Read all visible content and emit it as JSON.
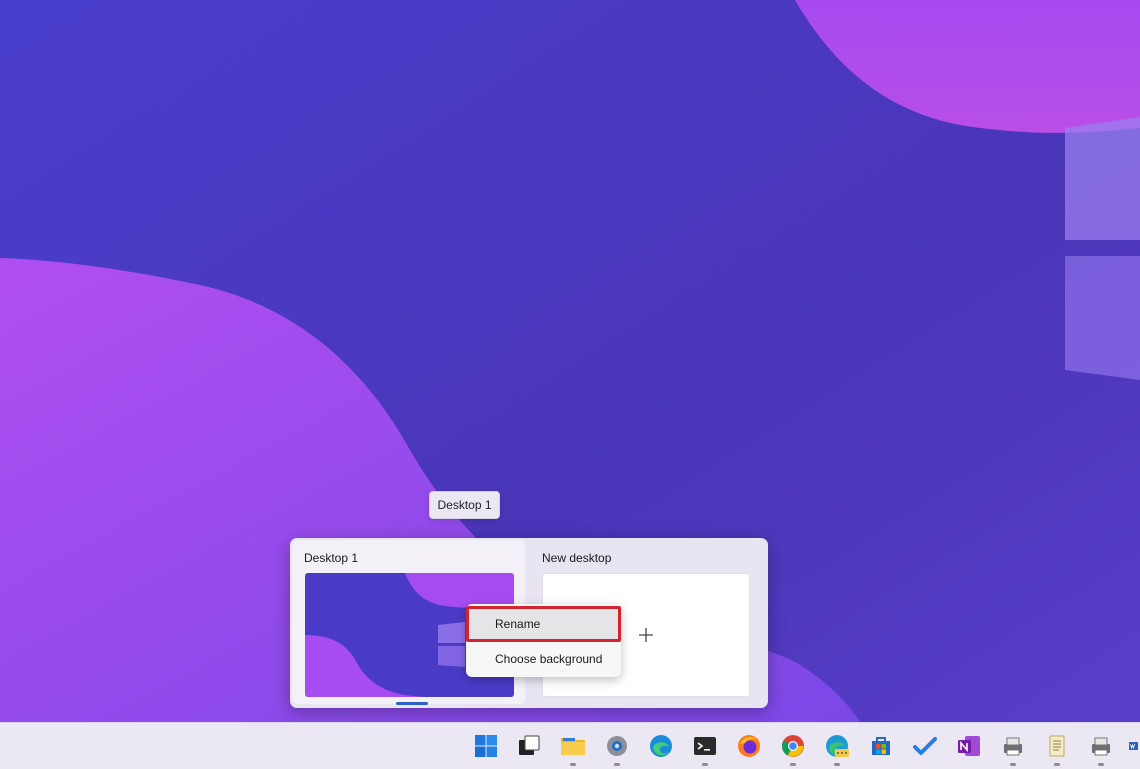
{
  "tooltip": {
    "text": "Desktop 1"
  },
  "task_view": {
    "desktops": [
      {
        "label": "Desktop 1",
        "active": true
      },
      {
        "label": "New desktop",
        "add_icon": "plus-icon"
      }
    ]
  },
  "context_menu": {
    "items": [
      {
        "label": "Rename",
        "highlighted": true
      },
      {
        "label": "Choose background"
      }
    ]
  },
  "taskbar": {
    "icons": [
      "start-icon",
      "task-view-icon",
      "file-explorer-icon",
      "settings-icon",
      "edge-icon",
      "terminal-icon",
      "firefox-icon",
      "chrome-icon",
      "edge-canary-icon",
      "store-icon",
      "todo-icon",
      "onenote-icon",
      "printer-app-icon",
      "notepad-icon",
      "printer-app-icon-2",
      "word-icon"
    ]
  },
  "colors": {
    "accent": "#2c63c2",
    "highlight_border": "#d42430",
    "wallpaper_base": "#4b3cc4",
    "wallpaper_wave": "#a44cf0"
  }
}
